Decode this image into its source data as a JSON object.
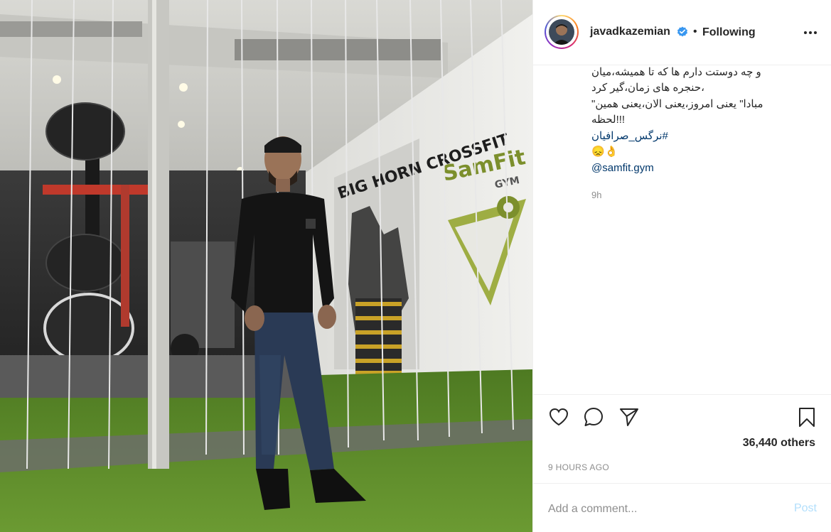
{
  "post": {
    "username": "javadkazemian",
    "separator": "•",
    "follow_state": "Following",
    "more_options_icon": "more-horizontal-icon",
    "verified_icon": "verified-badge-icon"
  },
  "photo_signage": {
    "sign_left": "BIG HORN CROSSFIT",
    "sign_right_brand": "SamFit",
    "sign_right_sub": "GYM"
  },
  "caption": {
    "line1": "و چه دوستت دارم ها که تا همیشه،میان",
    "line2": "،حنجره های زمان،گیر کرد",
    "line3": "مبادا\" یعنی امروز،یعنی الان،یعنی همین\"",
    "line4": "!!!لحظه",
    "hashtag": "#نرگس_صرافیان",
    "emojis": "😞👌",
    "mention": "@samfit.gym",
    "age": "9h"
  },
  "actions": {
    "like_icon": "heart-icon",
    "comment_icon": "comment-icon",
    "share_icon": "paper-plane-icon",
    "save_icon": "bookmark-icon",
    "likes_text": "36,440 others",
    "timestamp": "9 HOURS AGO"
  },
  "comment": {
    "placeholder": "Add a comment...",
    "post_label": "Post",
    "post_color": "#b2dffc"
  },
  "colors": {
    "link": "#00376b",
    "verified": "#3897f0",
    "muted": "#8e8e8e",
    "turf": "#5d8a2a"
  }
}
